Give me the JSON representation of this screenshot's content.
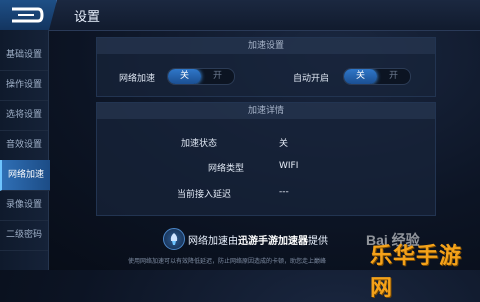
{
  "header": {
    "title": "设置",
    "back_icon": "back-arrow-icon"
  },
  "sidebar": {
    "items": [
      {
        "label": "基础设置",
        "active": false
      },
      {
        "label": "操作设置",
        "active": false
      },
      {
        "label": "选将设置",
        "active": false
      },
      {
        "label": "音效设置",
        "active": false
      },
      {
        "label": "网络加速",
        "active": true
      },
      {
        "label": "录像设置",
        "active": false
      },
      {
        "label": "二级密码",
        "active": false
      }
    ]
  },
  "accel_settings": {
    "header": "加速设置",
    "network_accel": {
      "label": "网络加速",
      "on": "关",
      "off": "开"
    },
    "auto_start": {
      "label": "自动开启",
      "on": "关",
      "off": "开"
    }
  },
  "accel_details": {
    "header": "加速详情",
    "rows": [
      {
        "label": "加速状态",
        "value": "关"
      },
      {
        "label": "网络类型",
        "value": "WIFI"
      },
      {
        "label": "当前接入延迟",
        "value": "---"
      }
    ]
  },
  "footer": {
    "provider_prefix": "网络加速由",
    "provider_name": "迅游手游加速器",
    "provider_suffix": "提供",
    "note": "使用网络加速可以有效降低延迟，防止网络原因造成的卡顿，助您走上巅峰"
  },
  "watermark": {
    "baidu": "Bai 经验",
    "site": "乐华手游网"
  }
}
